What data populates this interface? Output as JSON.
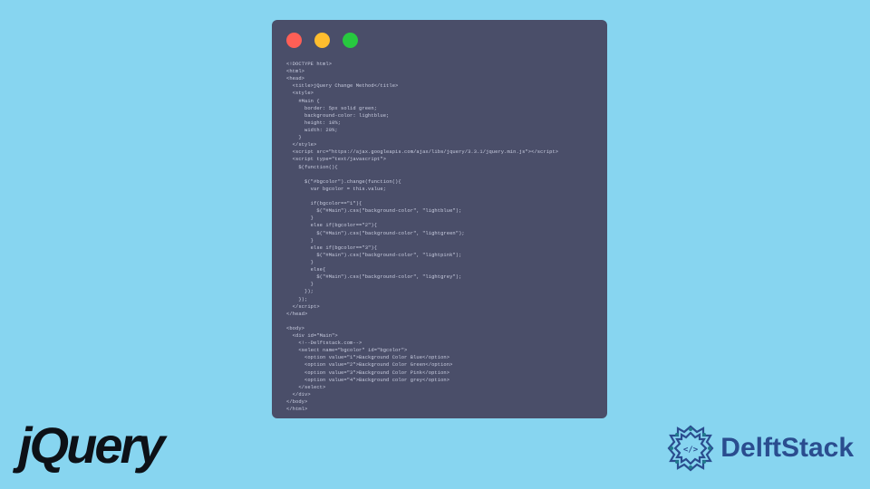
{
  "window": {
    "dots": [
      "red",
      "yellow",
      "green"
    ]
  },
  "code": {
    "lines": [
      "<!DOCTYPE html>",
      "<html>",
      "<head>",
      "  <title>jQuery Change Method</title>",
      "  <style>",
      "    #Main {",
      "      border: 5px solid green;",
      "      background-color: lightblue;",
      "      height: 10%;",
      "      width: 20%;",
      "    }",
      "  </style>",
      "  <script src=\"https://ajax.googleapis.com/ajax/libs/jquery/3.3.1/jquery.min.js\"></script>",
      "  <script type=\"text/javascript\">",
      "    $(function(){",
      "",
      "      $(\"#bgcolor\").change(function(){",
      "        var bgcolor = this.value;",
      "",
      "        if(bgcolor==\"1\"){",
      "          $(\"#Main\").css(\"background-color\", \"lightblue\");",
      "        }",
      "        else if(bgcolor==\"2\"){",
      "          $(\"#Main\").css(\"background-color\", \"lightgreen\");",
      "        }",
      "        else if(bgcolor==\"3\"){",
      "          $(\"#Main\").css(\"background-color\", \"lightpink\");",
      "        }",
      "        else{",
      "          $(\"#Main\").css(\"background-color\", \"lightgrey\");",
      "        }",
      "      });",
      "    });",
      "  </script>",
      "</head>",
      "",
      "<body>",
      "  <div id=\"Main\">",
      "    <!--Delftstack.com-->",
      "    <select name=\"bgcolor\" id=\"bgcolor\">",
      "      <option value=\"1\">Background Color Blue</option>",
      "      <option value=\"2\">Background Color Green</option>",
      "      <option value=\"3\">Background Color Pink</option>",
      "      <option value=\"4\">Background color grey</option>",
      "    </select>",
      "  </div>",
      "</body>",
      "</html>"
    ]
  },
  "logos": {
    "jquery": "jQuery",
    "delftstack": "DelftStack"
  },
  "colors": {
    "background": "#87d5f0",
    "window_bg": "#4a4e69",
    "code_text": "#c9cde0",
    "jquery_color": "#0d1117",
    "delftstack_color": "#2a4d8f",
    "delftstack_accent": "#1f7a8c"
  }
}
